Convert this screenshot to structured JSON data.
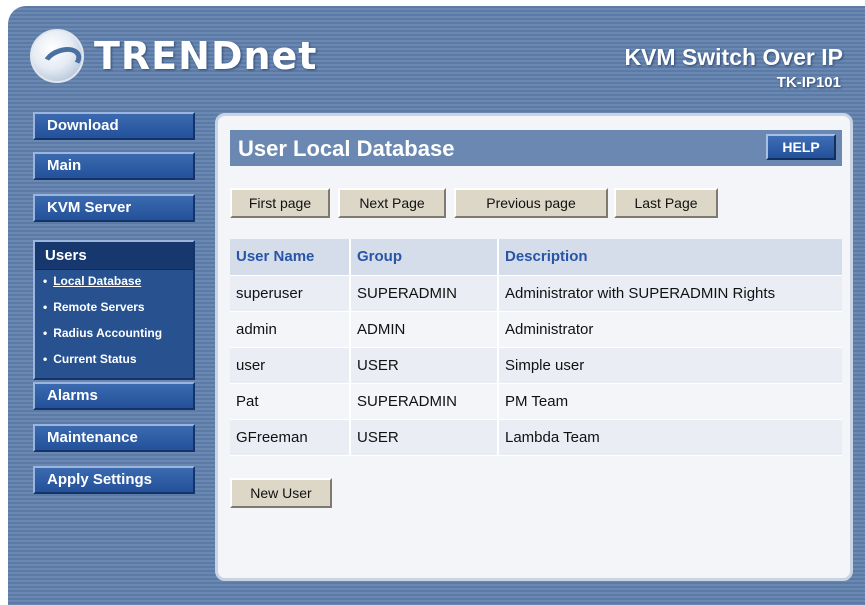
{
  "header": {
    "logo_text": "TRENDnet",
    "product_title": "KVM Switch Over IP",
    "model": "TK-IP101"
  },
  "sidebar": {
    "download": "Download",
    "main": "Main",
    "kvm_server": "KVM Server",
    "users": {
      "title": "Users",
      "items": [
        {
          "label": "Local Database",
          "active": true
        },
        {
          "label": "Remote Servers"
        },
        {
          "label": "Radius Accounting"
        },
        {
          "label": "Current Status"
        }
      ]
    },
    "alarms": "Alarms",
    "maintenance": "Maintenance",
    "apply_settings": "Apply Settings"
  },
  "main": {
    "title": "User Local Database",
    "help_label": "HELP",
    "pagination": {
      "first": "First page",
      "next": "Next Page",
      "previous": "Previous page",
      "last": "Last Page"
    },
    "table": {
      "columns": [
        "User Name",
        "Group",
        "Description"
      ],
      "rows": [
        [
          "superuser",
          "SUPERADMIN",
          "Administrator with SUPERADMIN Rights"
        ],
        [
          "admin",
          "ADMIN",
          "Administrator"
        ],
        [
          "user",
          "USER",
          "Simple user"
        ],
        [
          "Pat",
          "SUPERADMIN",
          "PM Team"
        ],
        [
          "GFreeman",
          "USER",
          "Lambda Team"
        ]
      ]
    },
    "new_user_label": "New User"
  },
  "colors": {
    "frame": "#5b7aa6",
    "nav_button": "#24519a",
    "active_section": "#16386f",
    "table_header_text": "#2855a6"
  }
}
